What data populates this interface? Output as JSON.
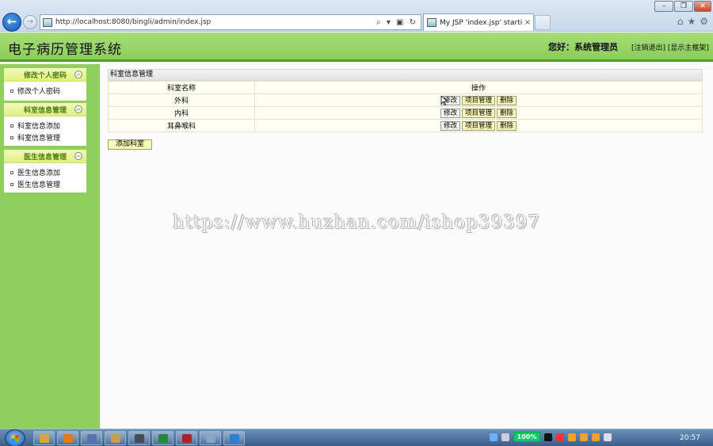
{
  "browser": {
    "window_buttons": [
      "–",
      "❐",
      "✕"
    ],
    "address_url": "http://localhost:8080/bingli/admin/index.jsp",
    "address_tools": "⌕ ▾ ▣ ↻",
    "tab_title": "My JSP 'index.jsp' startin...",
    "tab_close": "×",
    "back_glyph": "←",
    "forward_glyph": "→",
    "toolbar_icons": [
      "⌂",
      "★",
      "⚙"
    ]
  },
  "header": {
    "title": "电子病历管理系统",
    "greeting": "您好：系统管理员",
    "links": "[注销退出] [显示主框架]"
  },
  "sidebar": {
    "groups": [
      {
        "title": "修改个人密码",
        "items": [
          "修改个人密码"
        ]
      },
      {
        "title": "科室信息管理",
        "items": [
          "科室信息添加",
          "科室信息管理"
        ]
      },
      {
        "title": "医生信息管理",
        "items": [
          "医生信息添加",
          "医生信息管理"
        ]
      }
    ],
    "collapse_glyph": "︽"
  },
  "main": {
    "panel_title": "科室信息管理",
    "columns": [
      "科室名称",
      "操作"
    ],
    "rows": [
      {
        "name": "外科"
      },
      {
        "name": "内科"
      },
      {
        "name": "耳鼻喉科"
      }
    ],
    "actions": {
      "edit": "修改",
      "project": "项目管理",
      "delete": "删除"
    },
    "add_button": "添加科室"
  },
  "watermark": "https://www.huzhan.com/ishop39397",
  "taskbar": {
    "battery": "100%",
    "clock": "20:57",
    "app_colors": [
      "#d9a441",
      "#e2791f",
      "#5b6fb3",
      "#c9a04a",
      "#444a55",
      "#1e8a3a",
      "#a6232b",
      "#8aa4c8",
      "#2a7fd4"
    ]
  }
}
